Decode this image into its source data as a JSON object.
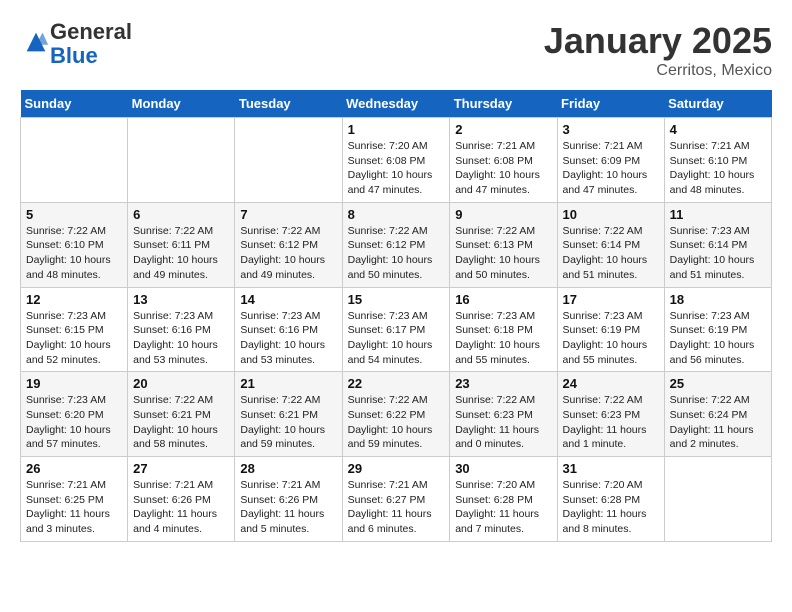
{
  "header": {
    "logo_general": "General",
    "logo_blue": "Blue",
    "month": "January 2025",
    "location": "Cerritos, Mexico"
  },
  "weekdays": [
    "Sunday",
    "Monday",
    "Tuesday",
    "Wednesday",
    "Thursday",
    "Friday",
    "Saturday"
  ],
  "weeks": [
    [
      {
        "day": "",
        "info": ""
      },
      {
        "day": "",
        "info": ""
      },
      {
        "day": "",
        "info": ""
      },
      {
        "day": "1",
        "info": "Sunrise: 7:20 AM\nSunset: 6:08 PM\nDaylight: 10 hours\nand 47 minutes."
      },
      {
        "day": "2",
        "info": "Sunrise: 7:21 AM\nSunset: 6:08 PM\nDaylight: 10 hours\nand 47 minutes."
      },
      {
        "day": "3",
        "info": "Sunrise: 7:21 AM\nSunset: 6:09 PM\nDaylight: 10 hours\nand 47 minutes."
      },
      {
        "day": "4",
        "info": "Sunrise: 7:21 AM\nSunset: 6:10 PM\nDaylight: 10 hours\nand 48 minutes."
      }
    ],
    [
      {
        "day": "5",
        "info": "Sunrise: 7:22 AM\nSunset: 6:10 PM\nDaylight: 10 hours\nand 48 minutes."
      },
      {
        "day": "6",
        "info": "Sunrise: 7:22 AM\nSunset: 6:11 PM\nDaylight: 10 hours\nand 49 minutes."
      },
      {
        "day": "7",
        "info": "Sunrise: 7:22 AM\nSunset: 6:12 PM\nDaylight: 10 hours\nand 49 minutes."
      },
      {
        "day": "8",
        "info": "Sunrise: 7:22 AM\nSunset: 6:12 PM\nDaylight: 10 hours\nand 50 minutes."
      },
      {
        "day": "9",
        "info": "Sunrise: 7:22 AM\nSunset: 6:13 PM\nDaylight: 10 hours\nand 50 minutes."
      },
      {
        "day": "10",
        "info": "Sunrise: 7:22 AM\nSunset: 6:14 PM\nDaylight: 10 hours\nand 51 minutes."
      },
      {
        "day": "11",
        "info": "Sunrise: 7:23 AM\nSunset: 6:14 PM\nDaylight: 10 hours\nand 51 minutes."
      }
    ],
    [
      {
        "day": "12",
        "info": "Sunrise: 7:23 AM\nSunset: 6:15 PM\nDaylight: 10 hours\nand 52 minutes."
      },
      {
        "day": "13",
        "info": "Sunrise: 7:23 AM\nSunset: 6:16 PM\nDaylight: 10 hours\nand 53 minutes."
      },
      {
        "day": "14",
        "info": "Sunrise: 7:23 AM\nSunset: 6:16 PM\nDaylight: 10 hours\nand 53 minutes."
      },
      {
        "day": "15",
        "info": "Sunrise: 7:23 AM\nSunset: 6:17 PM\nDaylight: 10 hours\nand 54 minutes."
      },
      {
        "day": "16",
        "info": "Sunrise: 7:23 AM\nSunset: 6:18 PM\nDaylight: 10 hours\nand 55 minutes."
      },
      {
        "day": "17",
        "info": "Sunrise: 7:23 AM\nSunset: 6:19 PM\nDaylight: 10 hours\nand 55 minutes."
      },
      {
        "day": "18",
        "info": "Sunrise: 7:23 AM\nSunset: 6:19 PM\nDaylight: 10 hours\nand 56 minutes."
      }
    ],
    [
      {
        "day": "19",
        "info": "Sunrise: 7:23 AM\nSunset: 6:20 PM\nDaylight: 10 hours\nand 57 minutes."
      },
      {
        "day": "20",
        "info": "Sunrise: 7:22 AM\nSunset: 6:21 PM\nDaylight: 10 hours\nand 58 minutes."
      },
      {
        "day": "21",
        "info": "Sunrise: 7:22 AM\nSunset: 6:21 PM\nDaylight: 10 hours\nand 59 minutes."
      },
      {
        "day": "22",
        "info": "Sunrise: 7:22 AM\nSunset: 6:22 PM\nDaylight: 10 hours\nand 59 minutes."
      },
      {
        "day": "23",
        "info": "Sunrise: 7:22 AM\nSunset: 6:23 PM\nDaylight: 11 hours\nand 0 minutes."
      },
      {
        "day": "24",
        "info": "Sunrise: 7:22 AM\nSunset: 6:23 PM\nDaylight: 11 hours\nand 1 minute."
      },
      {
        "day": "25",
        "info": "Sunrise: 7:22 AM\nSunset: 6:24 PM\nDaylight: 11 hours\nand 2 minutes."
      }
    ],
    [
      {
        "day": "26",
        "info": "Sunrise: 7:21 AM\nSunset: 6:25 PM\nDaylight: 11 hours\nand 3 minutes."
      },
      {
        "day": "27",
        "info": "Sunrise: 7:21 AM\nSunset: 6:26 PM\nDaylight: 11 hours\nand 4 minutes."
      },
      {
        "day": "28",
        "info": "Sunrise: 7:21 AM\nSunset: 6:26 PM\nDaylight: 11 hours\nand 5 minutes."
      },
      {
        "day": "29",
        "info": "Sunrise: 7:21 AM\nSunset: 6:27 PM\nDaylight: 11 hours\nand 6 minutes."
      },
      {
        "day": "30",
        "info": "Sunrise: 7:20 AM\nSunset: 6:28 PM\nDaylight: 11 hours\nand 7 minutes."
      },
      {
        "day": "31",
        "info": "Sunrise: 7:20 AM\nSunset: 6:28 PM\nDaylight: 11 hours\nand 8 minutes."
      },
      {
        "day": "",
        "info": ""
      }
    ]
  ]
}
